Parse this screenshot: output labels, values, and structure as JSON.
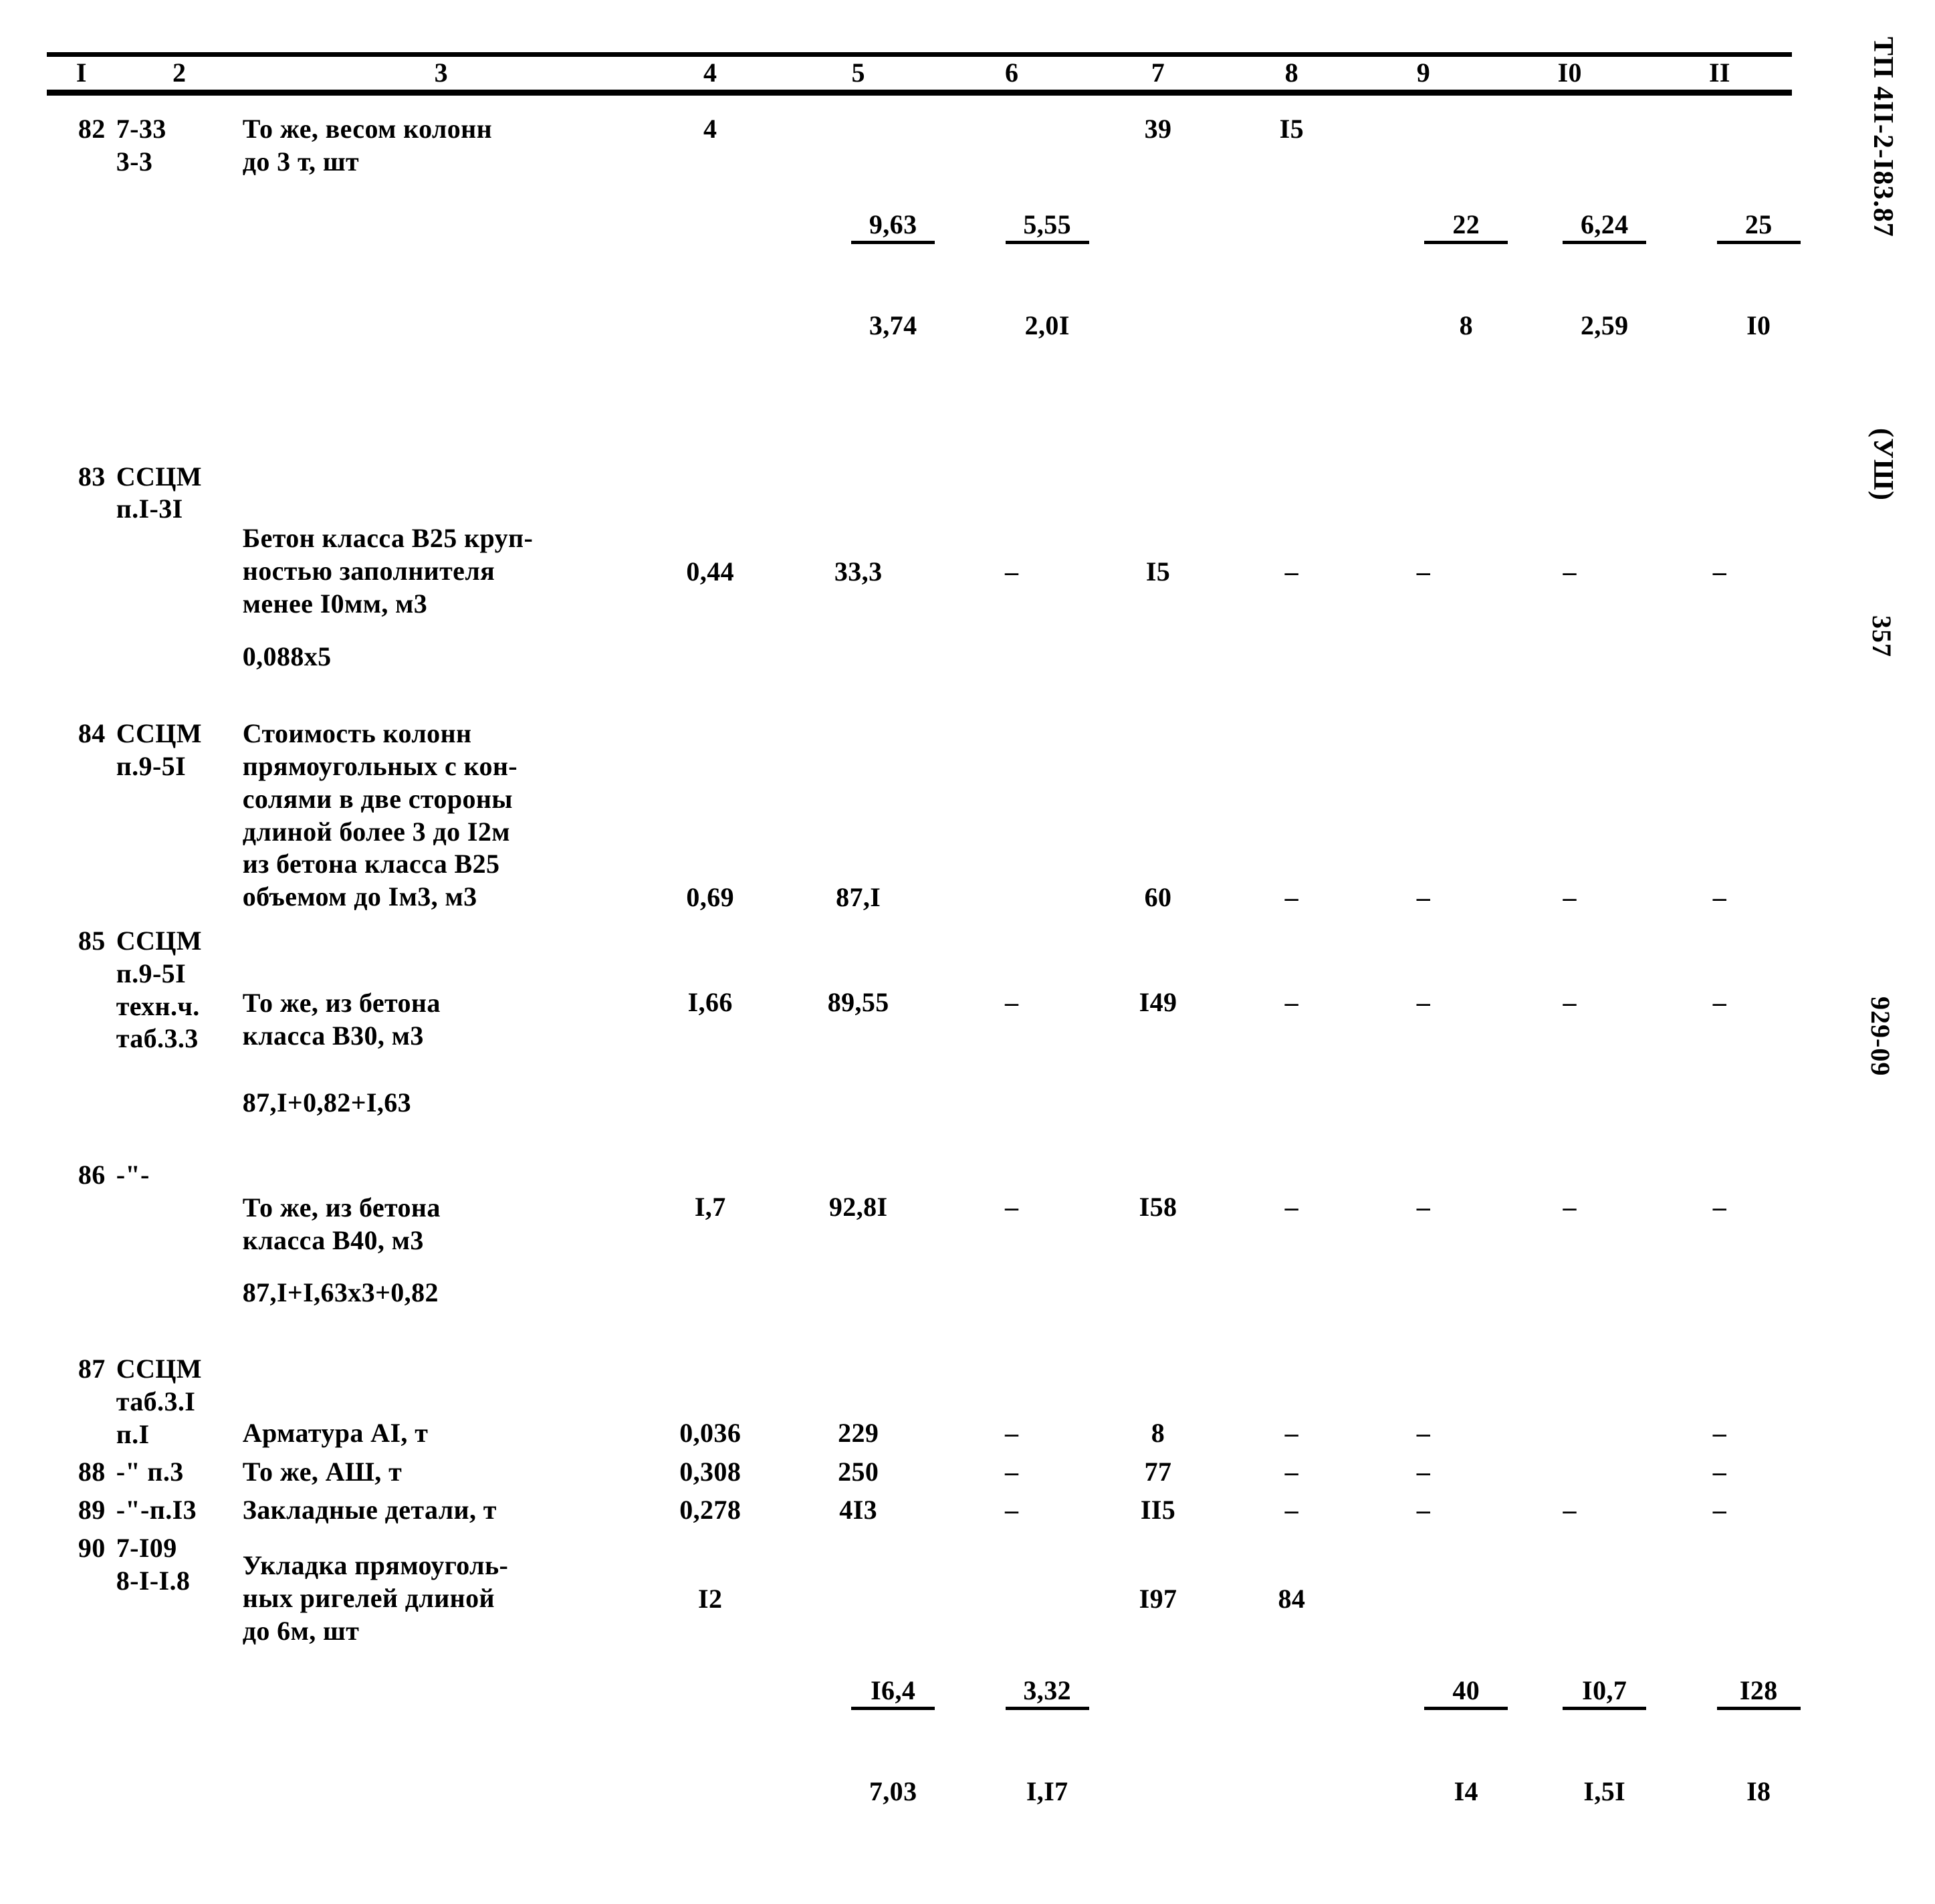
{
  "document": {
    "margin_doc_code": "ТП 4II-2-I83.87",
    "margin_variant": "(УШ)",
    "margin_page_number": "357",
    "margin_order_number": "929-09"
  },
  "table": {
    "columns": [
      "I",
      "2",
      "3",
      "4",
      "5",
      "6",
      "7",
      "8",
      "9",
      "I0",
      "II"
    ],
    "rows": [
      {
        "c1": "82",
        "c2": "7-33\n3-3",
        "c3": "То же, весом колонн\nдо 3 т,  шт",
        "c4": "4",
        "c5_top": "9,63",
        "c5_bot": "3,74",
        "c6_top": "5,55",
        "c6_bot": "2,0I",
        "c7": "39",
        "c8": "I5",
        "c9_top": "22",
        "c9_bot": "8",
        "c10_top": "6,24",
        "c10_bot": "2,59",
        "c11_top": "25",
        "c11_bot": "I0"
      },
      {
        "c1": "83",
        "c2": "ССЦМ\nп.I-3I",
        "c3": "Бетон класса В25 круп-\nностью заполнителя\nменее I0мм, м3",
        "c3_extra": "0,088х5",
        "c4": "0,44",
        "c5": "33,3",
        "c6": "–",
        "c7": "I5",
        "c8": "–",
        "c9": "–",
        "c10": "–",
        "c11": "–"
      },
      {
        "c1": "84",
        "c2": "ССЦМ\nп.9-5I",
        "c3": "Стоимость колонн\nпрямоугольных с кон-\nсолями в две стороны\nдлиной более 3 до I2м\nиз бетона класса В25\nобъемом до Iм3,  м3",
        "c4": "0,69",
        "c5": "87,I",
        "c6": "",
        "c7": "60",
        "c8": "–",
        "c9": "–",
        "c10": "–",
        "c11": "–"
      },
      {
        "c1": "85",
        "c2": "ССЦМ\nп.9-5I\nтехн.ч.\nтаб.3.3",
        "c3": "То же, из бетона\nкласса В30, м3",
        "c3_extra": "87,I+0,82+I,63",
        "c4": "I,66",
        "c5": "89,55",
        "c6": "–",
        "c7": "I49",
        "c8": "–",
        "c9": "–",
        "c10": "–",
        "c11": "–"
      },
      {
        "c1": "86",
        "c2": "-\"-",
        "c3": "То же, из бетона\nкласса В40, м3",
        "c3_extra": "87,I+I,63х3+0,82",
        "c4": "I,7",
        "c5": "92,8I",
        "c6": "–",
        "c7": "I58",
        "c8": "–",
        "c9": "–",
        "c10": "–",
        "c11": "–"
      },
      {
        "c1": "87",
        "c2": "ССЦМ\nтаб.3.I\nп.I",
        "c3": "Арматура АI, т",
        "c4": "0,036",
        "c5": "229",
        "c6": "–",
        "c7": "8",
        "c8": "–",
        "c9": "–",
        "c10": "",
        "c11": "–"
      },
      {
        "c1": "88",
        "c2": "-\" п.3",
        "c3": "То же, АШ, т",
        "c4": "0,308",
        "c5": "250",
        "c6": "–",
        "c7": "77",
        "c8": "–",
        "c9": "–",
        "c10": "",
        "c11": "–"
      },
      {
        "c1": "89",
        "c2": "-\"-п.I3",
        "c3": "Закладные детали, т",
        "c4": "0,278",
        "c5": "4I3",
        "c6": "–",
        "c7": "II5",
        "c8": "–",
        "c9": "–",
        "c10": "–",
        "c11": "–"
      },
      {
        "c1": "90",
        "c2": "7-I09\n8-I-I.8",
        "c3": "Укладка прямоуголь-\nных ригелей длиной\nдо 6м, шт",
        "c4": "I2",
        "c5_top": "I6,4",
        "c5_bot": "7,03",
        "c6_top": "3,32",
        "c6_bot": "I,I7",
        "c7": "I97",
        "c8": "84",
        "c9_top": "40",
        "c9_bot": "I4",
        "c10_top": "I0,7",
        "c10_bot": "I,5I",
        "c11_top": "I28",
        "c11_bot": "I8"
      }
    ]
  }
}
